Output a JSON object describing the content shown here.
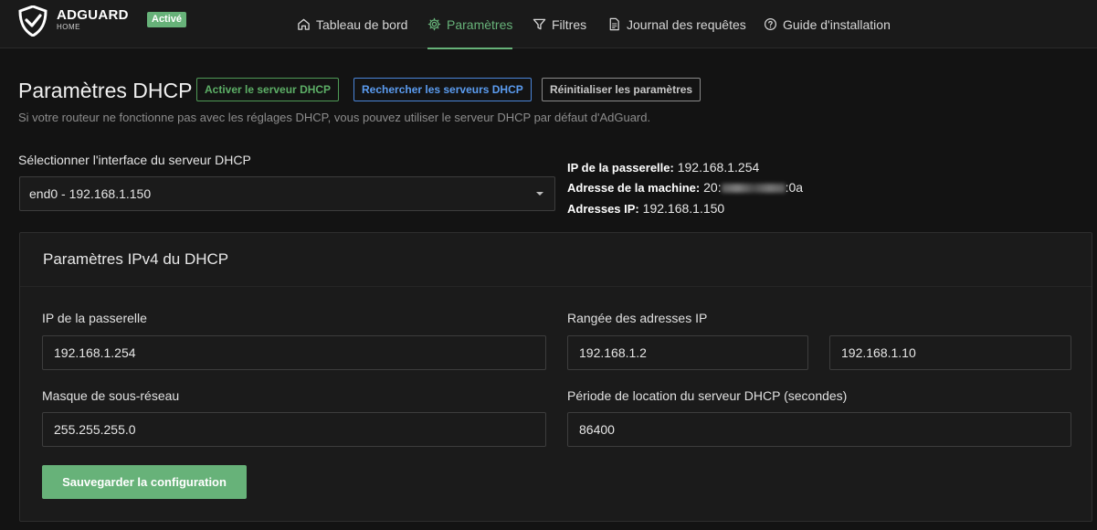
{
  "header": {
    "brand": "ADGUARD",
    "brand_sub": "HOME",
    "status_badge": "Activé",
    "nav": [
      {
        "label": "Tableau de bord",
        "icon": "home-icon"
      },
      {
        "label": "Paramètres",
        "icon": "gear-icon",
        "active": true
      },
      {
        "label": "Filtres",
        "icon": "filter-icon"
      },
      {
        "label": "Journal des requêtes",
        "icon": "document-icon"
      },
      {
        "label": "Guide d'installation",
        "icon": "help-circle-icon"
      }
    ]
  },
  "dhcp": {
    "title": "Paramètres DHCP",
    "enable_button": "Activer le serveur DHCP",
    "search_button": "Rechercher les serveurs DHCP",
    "reset_button": "Réinitialiser les paramètres",
    "description": "Si votre routeur ne fonctionne pas avec les réglages DHCP, vous pouvez utiliser le serveur DHCP par défaut d'AdGuard.",
    "interface_label": "Sélectionner l'interface du serveur DHCP",
    "interface_value": "end0 - 192.168.1.150",
    "info": {
      "gateway_label": "IP de la passerelle:",
      "gateway_value": "192.168.1.254",
      "mac_label": "Adresse de la machine:",
      "mac_prefix": "20:",
      "mac_suffix": ":0a",
      "ip_label": "Adresses IP:",
      "ip_value": "192.168.1.150"
    }
  },
  "ipv4": {
    "title": "Paramètres IPv4 du DHCP",
    "gateway_label": "IP de la passerelle",
    "gateway_value": "192.168.1.254",
    "range_label": "Rangée des adresses IP",
    "range_start": "192.168.1.2",
    "range_end": "192.168.1.10",
    "subnet_label": "Masque de sous-réseau",
    "subnet_value": "255.255.255.0",
    "lease_label": "Période de location du serveur DHCP (secondes)",
    "lease_value": "86400",
    "save_button": "Sauvegarder la configuration"
  },
  "colors": {
    "accent": "#67b279",
    "link_blue": "#5b9cf0",
    "background": "#131313"
  }
}
